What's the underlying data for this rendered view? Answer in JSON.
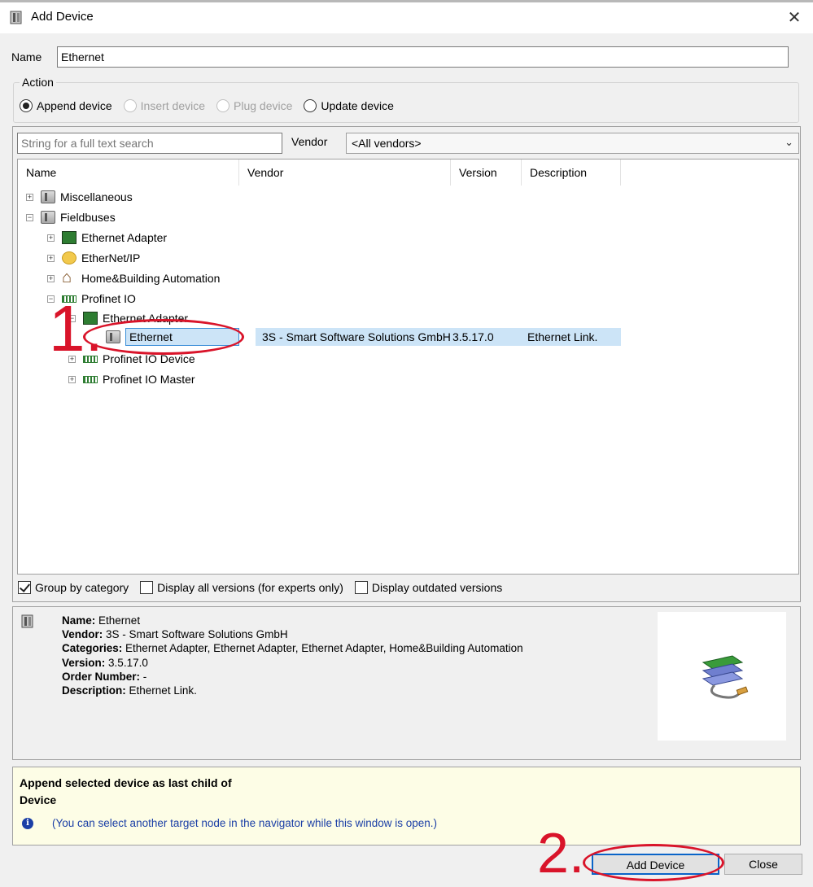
{
  "window": {
    "title": "Add Device",
    "close_label": "✕"
  },
  "name_field": {
    "label": "Name",
    "value": "Ethernet"
  },
  "action": {
    "legend": "Action",
    "options": [
      {
        "label": "Append device",
        "checked": true,
        "disabled": false
      },
      {
        "label": "Insert device",
        "checked": false,
        "disabled": true
      },
      {
        "label": "Plug device",
        "checked": false,
        "disabled": true
      },
      {
        "label": "Update device",
        "checked": false,
        "disabled": false
      }
    ]
  },
  "search": {
    "placeholder": "String for a full text search"
  },
  "vendor": {
    "label": "Vendor",
    "selected": "<All vendors>"
  },
  "columns": [
    "Name",
    "Vendor",
    "Version",
    "Description"
  ],
  "tree": [
    {
      "label": "Miscellaneous",
      "icon": "folder-icon",
      "expander": "+"
    },
    {
      "label": "Fieldbuses",
      "icon": "folder-icon",
      "expander": "−"
    },
    {
      "label": "Ethernet Adapter",
      "icon": "circuit-board-icon",
      "expander": "+"
    },
    {
      "label": "EtherNet/IP",
      "icon": "ethernet-ip-icon",
      "expander": "+"
    },
    {
      "label": "Home&Building Automation",
      "icon": "home-icon",
      "expander": "+"
    },
    {
      "label": "Profinet IO",
      "icon": "profinet-icon",
      "expander": "−"
    },
    {
      "label": "Ethernet Adapter",
      "icon": "circuit-board-icon",
      "expander": "−"
    },
    {
      "label": "Ethernet",
      "icon": "device-icon",
      "expander": ""
    },
    {
      "label": "Profinet IO Device",
      "icon": "profinet-icon",
      "expander": "+"
    },
    {
      "label": "Profinet IO Master",
      "icon": "profinet-icon",
      "expander": "+"
    }
  ],
  "selected_row": {
    "vendor": "3S - Smart Software Solutions GmbH",
    "version": "3.5.17.0",
    "description": "Ethernet Link."
  },
  "checkboxes": [
    {
      "label": "Group by category",
      "checked": true
    },
    {
      "label": "Display all versions (for experts only)",
      "checked": false
    },
    {
      "label": "Display outdated versions",
      "checked": false
    }
  ],
  "info": {
    "name_key": "Name:",
    "name_val": "Ethernet",
    "vendor_key": "Vendor:",
    "vendor_val": "3S - Smart Software Solutions GmbH",
    "categories_key": "Categories:",
    "categories_val": "Ethernet Adapter, Ethernet Adapter, Ethernet Adapter, Home&Building Automation",
    "version_key": "Version:",
    "version_val": "3.5.17.0",
    "order_key": "Order Number:",
    "order_val": "-",
    "description_key": "Description:",
    "description_val": "Ethernet Link."
  },
  "note": {
    "line1": "Append selected device as last child of",
    "line2": "Device",
    "hint": "(You can select another target node in the navigator while this window is open.)",
    "info_glyph": "i"
  },
  "buttons": {
    "add_device": "Add Device",
    "close": "Close"
  },
  "annotations": {
    "step1": "1.",
    "step2": "2."
  },
  "colors": {
    "annotation_red": "#d9142a",
    "selection_blue": "#cce4f7",
    "info_blue": "#1b3fa6",
    "note_bg": "#fdfde6"
  }
}
